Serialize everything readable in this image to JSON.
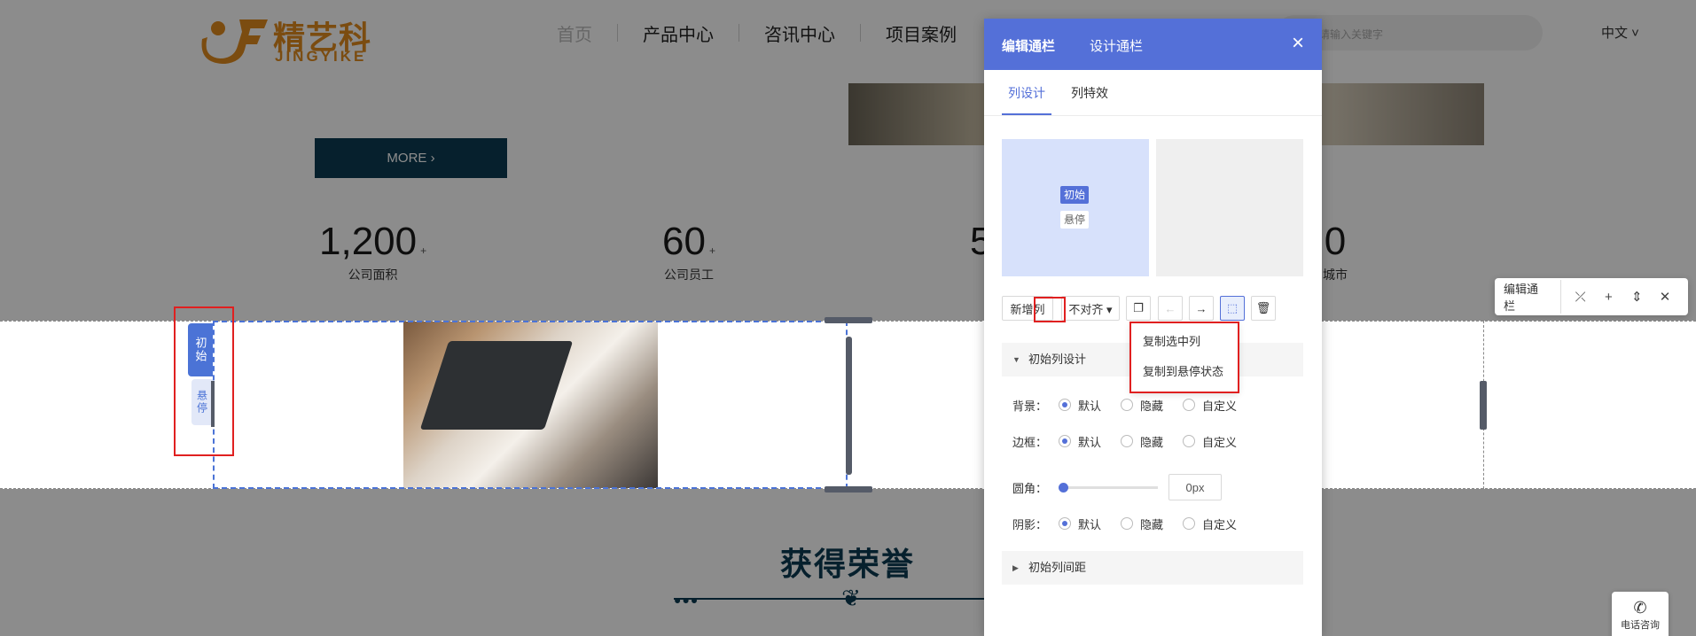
{
  "site": {
    "logo_cn": "精艺科",
    "logo_en": "JINGYIKE",
    "nav": [
      "首页",
      "产品中心",
      "咨讯中心",
      "项目案例"
    ],
    "search_placeholder": "请输入关键字",
    "lang": "中文 ˅",
    "more_label": "MORE ›",
    "stats": [
      {
        "num": "1,200",
        "plus": "+",
        "label": "公司面积"
      },
      {
        "num": "60",
        "plus": "+",
        "label": "公司员工"
      },
      {
        "num": "5",
        "plus": "",
        "label": ""
      },
      {
        "num": "0",
        "plus": "",
        "label": "城市"
      }
    ],
    "honor_title": "获得荣誉",
    "state_init": "初始",
    "state_hover": "悬停"
  },
  "float_toolbar": {
    "label": "编辑通栏",
    "icons": [
      "unlink-icon",
      "plus-icon",
      "move-updown-icon",
      "close-icon"
    ]
  },
  "phone": {
    "label": "电话咨询"
  },
  "panel": {
    "tabs": [
      "编辑通栏",
      "设计通栏"
    ],
    "close": "×",
    "sub_tabs": [
      "列设计",
      "列特效"
    ],
    "preview": {
      "init": "初始",
      "hover": "悬停"
    },
    "toolbar": {
      "add_col": "新增列",
      "align": "不对齐 ▾",
      "copy_icon": "copy-icon",
      "left_icon": "arrow-left-icon",
      "right_icon": "arrow-right-icon",
      "select_icon": "select-icon",
      "delete_icon": "trash-icon"
    },
    "dropdown": [
      "复制选中列",
      "复制到悬停状态"
    ],
    "section_init": "初始列设计",
    "section_spacing": "初始列间距",
    "props": {
      "bg": {
        "label": "背景：",
        "options": [
          "默认",
          "隐藏",
          "自定义"
        ],
        "selected": 0
      },
      "border": {
        "label": "边框：",
        "options": [
          "默认",
          "隐藏",
          "自定义"
        ],
        "selected": 0
      },
      "radius": {
        "label": "圆角：",
        "value": "0px",
        "level": 0
      },
      "shadow": {
        "label": "阴影：",
        "options": [
          "默认",
          "隐藏",
          "自定义"
        ],
        "selected": 0
      }
    }
  }
}
